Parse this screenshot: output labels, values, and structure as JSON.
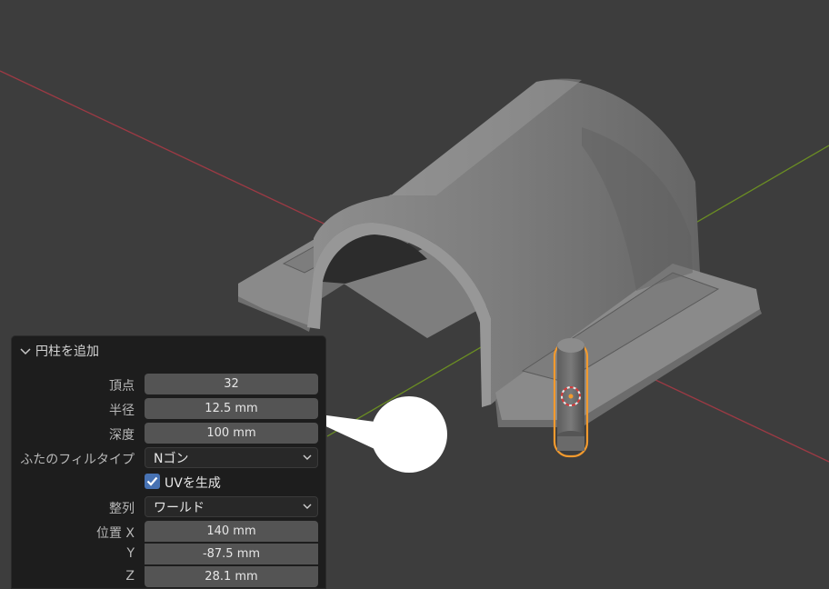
{
  "panel": {
    "title": "円柱を追加",
    "vertices": {
      "label": "頂点",
      "value": "32"
    },
    "radius": {
      "label": "半径",
      "value": "12.5 mm"
    },
    "depth": {
      "label": "深度",
      "value": "100 mm"
    },
    "cap_fill": {
      "label": "ふたのフィルタイプ",
      "value": "Nゴン"
    },
    "uv": {
      "label": "UVを生成",
      "checked": true
    },
    "align": {
      "label": "整列",
      "value": "ワールド"
    },
    "location": {
      "x": {
        "label": "位置 X",
        "value": "140 mm"
      },
      "y": {
        "label": "Y",
        "value": "-87.5 mm"
      },
      "z": {
        "label": "Z",
        "value": "28.1 mm"
      }
    }
  },
  "colors": {
    "accent": "#4772b3",
    "selection": "#f29a2e",
    "x_axis": "#9c3a44",
    "y_axis": "#6b8e23"
  }
}
